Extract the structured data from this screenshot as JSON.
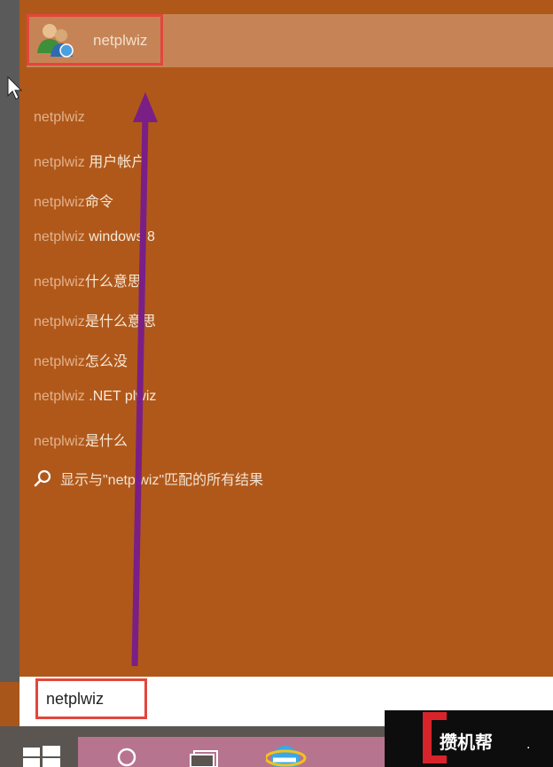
{
  "best_match": {
    "app_name": "netplwiz",
    "icon": "users-icon"
  },
  "suggestions": [
    {
      "base": "netplwiz",
      "extra": ""
    },
    {
      "base": "netplwiz ",
      "extra": "用户帐户"
    },
    {
      "base": "netplwiz",
      "extra": "命令"
    },
    {
      "base": "netplwiz ",
      "extra": "windows 8"
    },
    {
      "base": "netplwiz",
      "extra": "什么意思"
    },
    {
      "base": "netplwiz",
      "extra": "是什么意思"
    },
    {
      "base": "netplwiz",
      "extra": "怎么没"
    },
    {
      "base": "netplwiz ",
      "extra": ".NET plwiz"
    },
    {
      "base": "netplwiz",
      "extra": "是什么"
    }
  ],
  "search_all": {
    "label": "显示与\"netplwiz\"匹配的所有结果",
    "icon": "search-icon"
  },
  "search_box": {
    "value": "netplwiz"
  },
  "taskbar": {
    "start_icon": "windows-logo-icon",
    "search_icon": "search-icon",
    "taskview_icon": "task-view-icon",
    "ie_icon": "internet-explorer-icon"
  },
  "watermark": {
    "text": "攒机帮",
    "dot": "."
  },
  "colors": {
    "panel": "#b0581a",
    "highlight_border": "#e2463c",
    "arrow": "#7a1f86"
  }
}
